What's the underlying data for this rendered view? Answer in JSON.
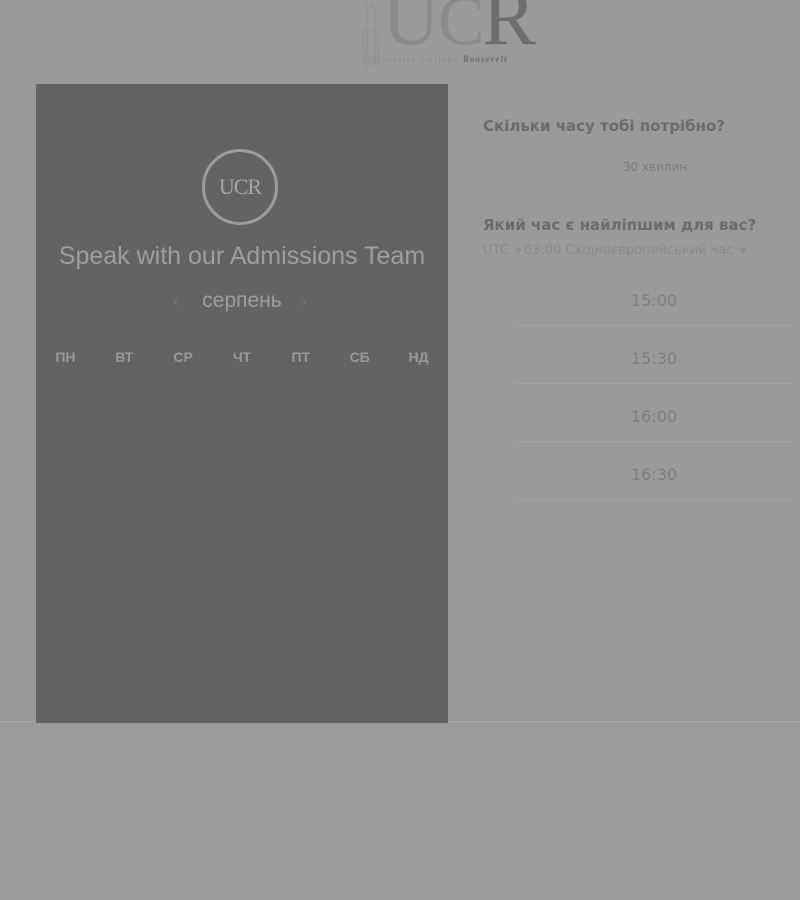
{
  "header": {
    "logo_mark": "UCR",
    "logo_tagline_prefix": "University College",
    "logo_tagline_name": "Roosevelt"
  },
  "calendar": {
    "logo_text": "UCR",
    "title": "Speak with our Admissions Team",
    "month": "серпень",
    "prev_icon": "‹",
    "next_icon": "›",
    "weekdays": [
      "ПН",
      "ВТ",
      "СР",
      "ЧТ",
      "ПТ",
      "СБ",
      "НД"
    ]
  },
  "booking": {
    "duration_question": "Скільки часу тобі потрібно?",
    "duration_value": "30 хвилин",
    "time_question": "Який час є найліпшим для вас?",
    "timezone": "UTC +03:00 Східноєвропейський час",
    "timezone_caret": "▼",
    "slots": [
      "15:00",
      "15:30",
      "16:00",
      "16:30"
    ]
  },
  "colors": {
    "overlay_background": "#9a9a9a",
    "card_background": "#636363"
  }
}
